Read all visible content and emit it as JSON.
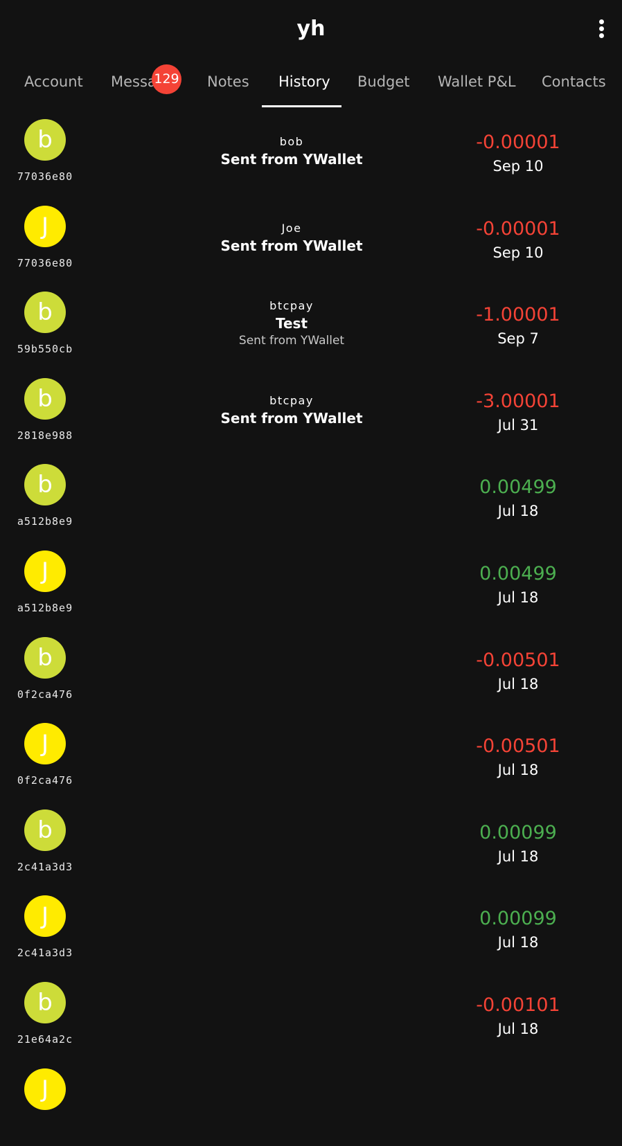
{
  "app": {
    "title": "yh"
  },
  "tabs": [
    "Account",
    "Messages",
    "Notes",
    "History",
    "Budget",
    "Wallet P&L",
    "Contacts"
  ],
  "active_tab": "History",
  "messages_badge": "129",
  "colors": {
    "negative": "#f44336",
    "positive": "#4caf50",
    "avatar_b": "#cddc39",
    "avatar_j": "#ffeb00"
  },
  "transactions": [
    {
      "avatar": "b",
      "txid": "77036e80",
      "who": "bob",
      "subject": "Sent from YWallet",
      "body": "",
      "amount": "-0.00001",
      "date": "Sep 10"
    },
    {
      "avatar": "J",
      "txid": "77036e80",
      "who": "Joe",
      "subject": "Sent from YWallet",
      "body": "",
      "amount": "-0.00001",
      "date": "Sep 10"
    },
    {
      "avatar": "b",
      "txid": "59b550cb",
      "who": "btcpay",
      "subject": "Test",
      "body": "Sent from YWallet",
      "amount": "-1.00001",
      "date": "Sep 7"
    },
    {
      "avatar": "b",
      "txid": "2818e988",
      "who": "btcpay",
      "subject": "Sent from YWallet",
      "body": "",
      "amount": "-3.00001",
      "date": "Jul 31"
    },
    {
      "avatar": "b",
      "txid": "a512b8e9",
      "who": "",
      "subject": "",
      "body": "",
      "amount": "0.00499",
      "date": "Jul 18"
    },
    {
      "avatar": "J",
      "txid": "a512b8e9",
      "who": "",
      "subject": "",
      "body": "",
      "amount": "0.00499",
      "date": "Jul 18"
    },
    {
      "avatar": "b",
      "txid": "0f2ca476",
      "who": "",
      "subject": "",
      "body": "",
      "amount": "-0.00501",
      "date": "Jul 18"
    },
    {
      "avatar": "J",
      "txid": "0f2ca476",
      "who": "",
      "subject": "",
      "body": "",
      "amount": "-0.00501",
      "date": "Jul 18"
    },
    {
      "avatar": "b",
      "txid": "2c41a3d3",
      "who": "",
      "subject": "",
      "body": "",
      "amount": "0.00099",
      "date": "Jul 18"
    },
    {
      "avatar": "J",
      "txid": "2c41a3d3",
      "who": "",
      "subject": "",
      "body": "",
      "amount": "0.00099",
      "date": "Jul 18"
    },
    {
      "avatar": "b",
      "txid": "21e64a2c",
      "who": "",
      "subject": "",
      "body": "",
      "amount": "-0.00101",
      "date": "Jul 18"
    },
    {
      "avatar": "J",
      "txid": "",
      "who": "",
      "subject": "",
      "body": "",
      "amount": "",
      "date": ""
    }
  ]
}
